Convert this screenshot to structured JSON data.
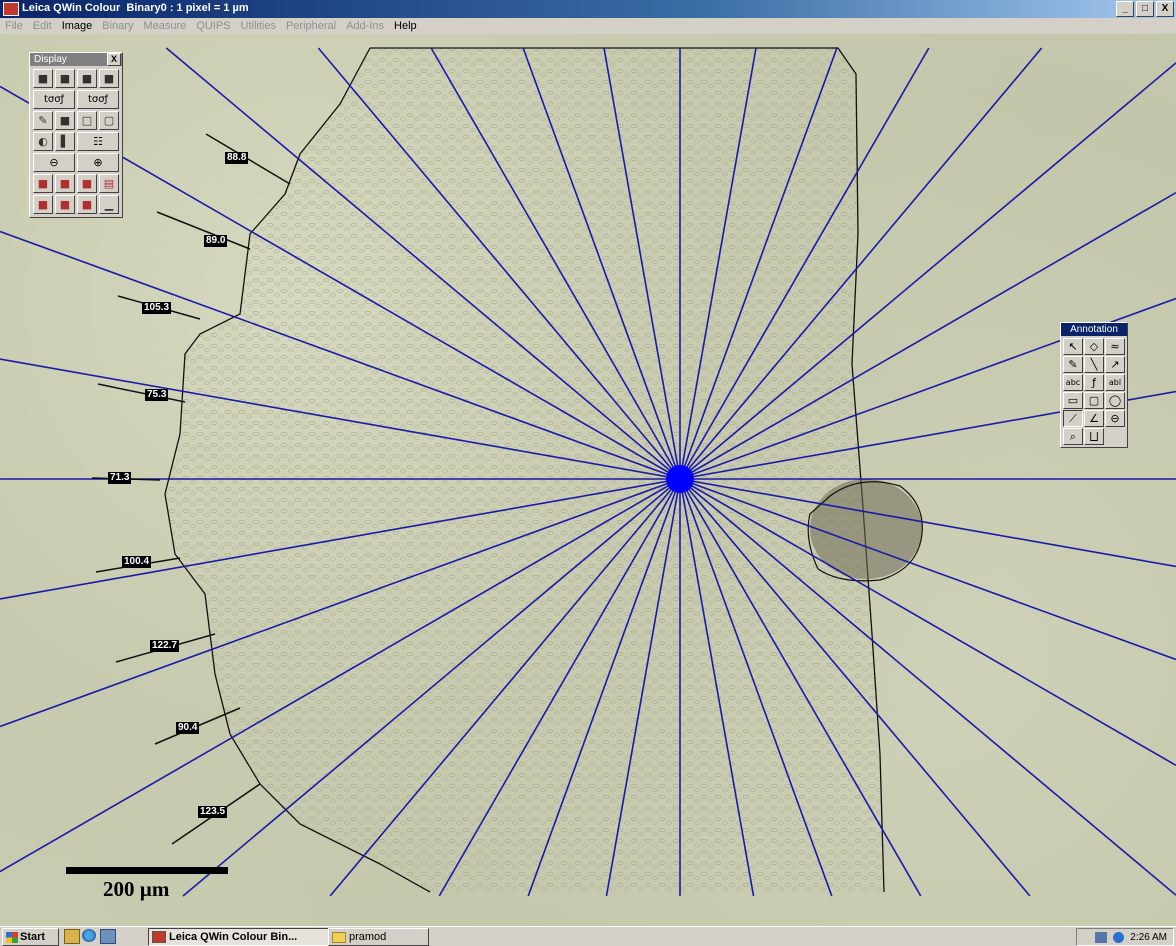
{
  "window": {
    "title": "Leica QWin Colour  Binary0 : 1 pixel = 1 µm",
    "buttons": [
      "_",
      "□",
      "X"
    ]
  },
  "menu": [
    {
      "label": "File",
      "enabled": false
    },
    {
      "label": "Edit",
      "enabled": false
    },
    {
      "label": "Image",
      "enabled": true
    },
    {
      "label": "Binary",
      "enabled": false
    },
    {
      "label": "Measure",
      "enabled": false
    },
    {
      "label": "QUIPS",
      "enabled": false
    },
    {
      "label": "Utilities",
      "enabled": false
    },
    {
      "label": "Peripheral",
      "enabled": false
    },
    {
      "label": "Add-Ins",
      "enabled": false
    },
    {
      "label": "Help",
      "enabled": true
    }
  ],
  "display_palette": {
    "title": "Display",
    "close": "X",
    "tools": [
      "zoom-fit-icon",
      "zoom-image-icon",
      "color-map-icon",
      "color-map-2-icon",
      "tied-view-icon",
      "tied-view-2-icon",
      "pencil-icon",
      "color-edit-icon",
      "frame-icon",
      "frame-blank-icon",
      "lut-icon",
      "color-bar-icon",
      "grid-icon",
      "zoom-out-icon",
      "zoom-in-icon",
      "overlay-icon",
      "overlay-2-icon",
      "overlay-3-icon",
      "overlay-folder-icon",
      "grab-icon",
      "grab-2-icon",
      "grab-3-icon",
      "histogram-icon"
    ],
    "labels": {
      "tied": "tσσƒ"
    }
  },
  "annotation_palette": {
    "title": "Annotation",
    "tools": [
      {
        "name": "select-arrow-icon",
        "glyph": "↖"
      },
      {
        "name": "eraser-icon",
        "glyph": "◇"
      },
      {
        "name": "fill-icon",
        "glyph": "≈"
      },
      {
        "name": "pen-icon",
        "glyph": "✎"
      },
      {
        "name": "line-icon",
        "glyph": "╲"
      },
      {
        "name": "arrow-icon",
        "glyph": "↗"
      },
      {
        "name": "text-abc-icon",
        "glyph": "abc"
      },
      {
        "name": "text-style-icon",
        "glyph": "ƒ"
      },
      {
        "name": "text-box-icon",
        "glyph": "abl"
      },
      {
        "name": "rectangle-icon",
        "glyph": "▭"
      },
      {
        "name": "rounded-rect-icon",
        "glyph": "▢"
      },
      {
        "name": "ellipse-icon",
        "glyph": "◯"
      },
      {
        "name": "measure-line-icon",
        "glyph": "⟋"
      },
      {
        "name": "angle-icon",
        "glyph": "∠"
      },
      {
        "name": "calibrate-icon",
        "glyph": "⊖"
      },
      {
        "name": "magnifier-icon",
        "glyph": "⌕"
      },
      {
        "name": "scale-icon",
        "glyph": "⨆"
      }
    ]
  },
  "image": {
    "measurements": [
      "88.8",
      "89.0",
      "105.3",
      "75.3",
      "71.3",
      "100.4",
      "122.7",
      "90.4",
      "123.5"
    ],
    "scale_bar_label": "200 µm",
    "line_color": "#1a1aa8",
    "center_color": "#0000ff"
  },
  "taskbar": {
    "start": "Start",
    "tasks": [
      {
        "label": "Leica QWin Colour  Bin...",
        "active": true
      },
      {
        "label": "pramod",
        "active": false
      }
    ],
    "clock": "2:26 AM"
  }
}
